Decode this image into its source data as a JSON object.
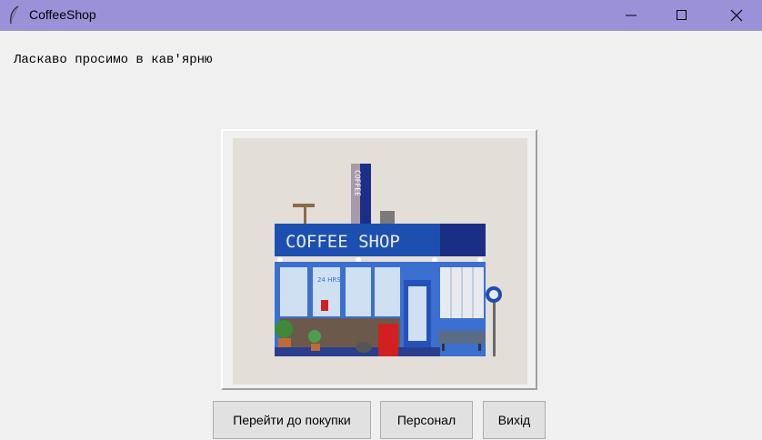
{
  "window": {
    "title": "CoffeeShop",
    "icon": "feather-icon"
  },
  "welcome_text": "Ласкаво просимо в кав'ярню",
  "image": {
    "sign_text": "COFFEE SHOP",
    "tower_text": "COFFEE",
    "window_sticker": "24 HRS"
  },
  "buttons": {
    "shop": "Перейти до покупки",
    "staff": "Персонал",
    "exit": "Вихід"
  },
  "colors": {
    "titlebar": "#9b91d9",
    "shop_blue": "#1d4fb0",
    "background": "#f0f0f0"
  }
}
